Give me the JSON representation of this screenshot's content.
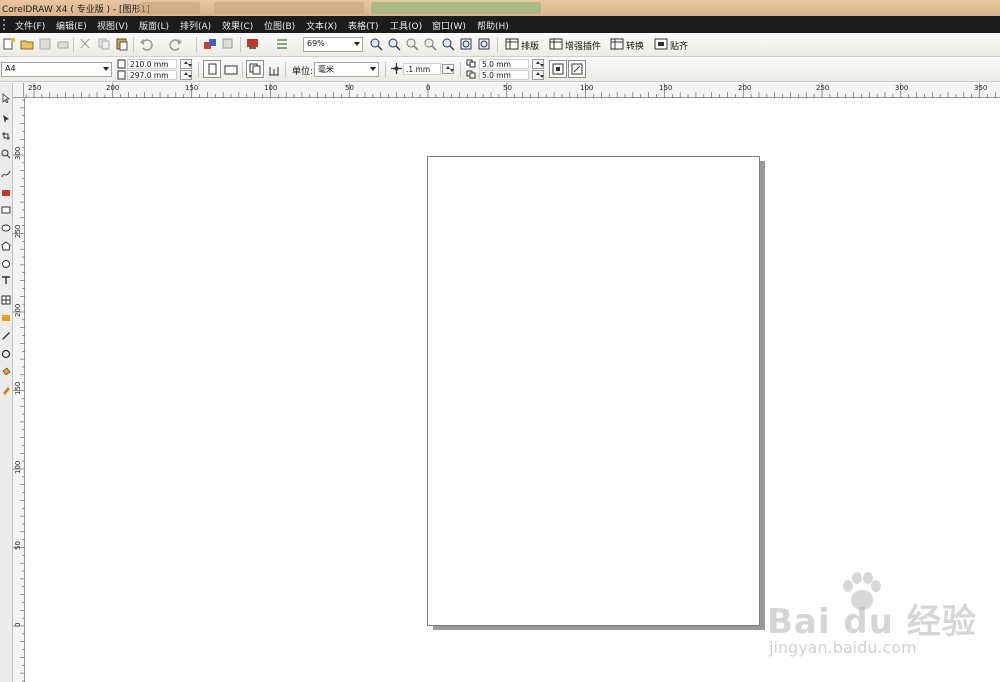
{
  "window": {
    "title": "CorelDRAW X4 ( 专业版 ) - [图形1]"
  },
  "menu": [
    "文件(F)",
    "编辑(E)",
    "视图(V)",
    "版面(L)",
    "排列(A)",
    "效果(C)",
    "位图(B)",
    "文本(X)",
    "表格(T)",
    "工具(O)",
    "窗口(W)",
    "帮助(H)"
  ],
  "toolbar": {
    "zoom_value": "69%",
    "buttons": [
      "排版",
      "增强插件",
      "转换",
      "贴齐"
    ]
  },
  "property_bar": {
    "paper_size": "A4",
    "width": "210.0 mm",
    "height": "297.0 mm",
    "units_label": "单位:",
    "units_value": "毫米",
    "nudge": ".1 mm",
    "dup_x": "5.0 mm",
    "dup_y": "5.0 mm"
  },
  "rulers": {
    "horizontal": [
      "250",
      "200",
      "150",
      "100",
      "50",
      "0",
      "50",
      "100",
      "150",
      "200",
      "250",
      "300",
      "350"
    ],
    "horizontal_unit": "毫米",
    "vertical": [
      "300",
      "250",
      "200",
      "150",
      "100",
      "50",
      "0"
    ]
  },
  "watermark": {
    "brand": "Bai du 经验",
    "url": "jingyan.baidu.com"
  },
  "colors": {
    "menu_bg": "#1c1c1c",
    "titlebar_bg": "#e3c199",
    "canvas_bg": "#ffffff",
    "page_shadow": "#9a9a9a"
  }
}
